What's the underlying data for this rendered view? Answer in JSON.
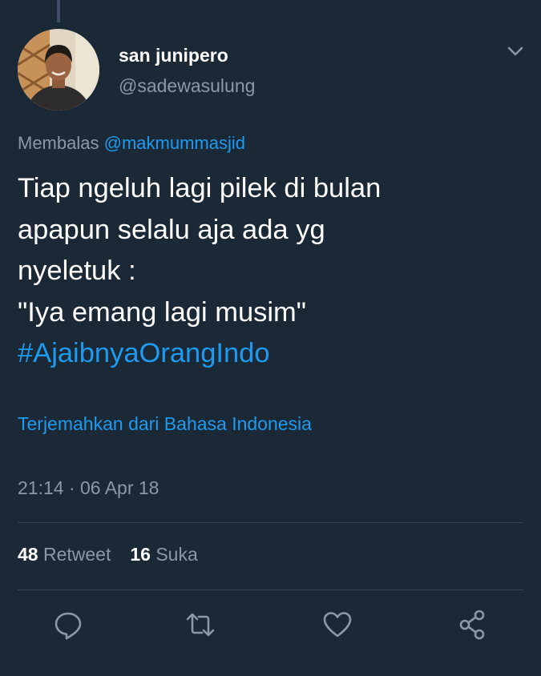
{
  "user": {
    "display_name": "san junipero",
    "handle": "@sadewasulung"
  },
  "reply": {
    "prefix": "Membalas",
    "mention": "@makmummasjid"
  },
  "tweet": {
    "lines": [
      "Tiap ngeluh lagi pilek di bulan",
      "apapun selalu aja ada yg",
      "nyeletuk :",
      "\"Iya emang lagi musim\""
    ],
    "hashtag": "#AjaibnyaOrangIndo"
  },
  "translate_label": "Terjemahkan dari Bahasa Indonesia",
  "timestamp": "21:14 · 06 Apr 18",
  "stats": {
    "retweet_count": "48",
    "retweet_label": "Retweet",
    "like_count": "16",
    "like_label": "Suka"
  },
  "icons": {
    "more": "chevron-down-icon",
    "reply": "reply-icon",
    "retweet": "retweet-icon",
    "like": "heart-icon",
    "share": "share-icon"
  },
  "colors": {
    "background": "#1b2836",
    "text": "#ffffff",
    "secondary": "#8b98a6",
    "accent": "#1d9bf0",
    "divider": "#38444d"
  }
}
